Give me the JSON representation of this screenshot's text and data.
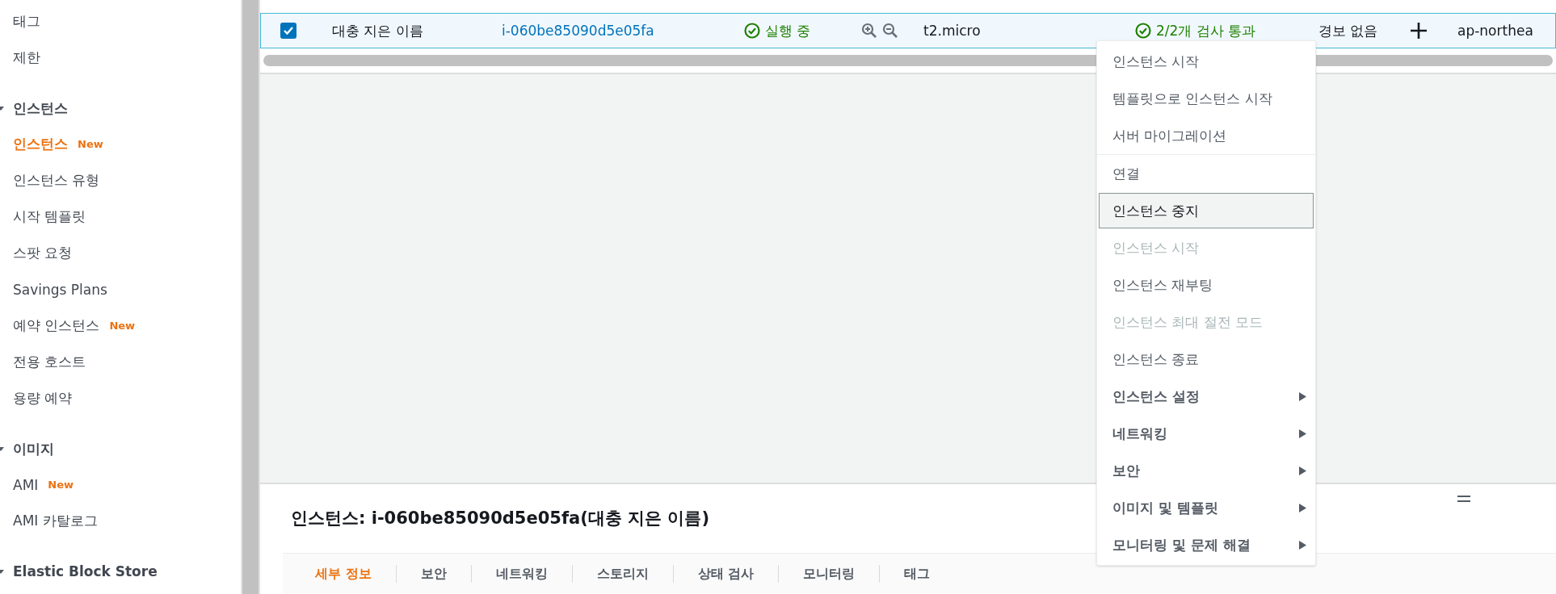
{
  "sidebar": {
    "sections": [
      {
        "items": [
          {
            "label": "태그",
            "selected": false
          },
          {
            "label": "제한",
            "selected": false
          }
        ]
      },
      {
        "title": "인스턴스",
        "expanded": true,
        "items": [
          {
            "label": "인스턴스",
            "selected": true,
            "badge": "New"
          },
          {
            "label": "인스턴스 유형",
            "selected": false
          },
          {
            "label": "시작 템플릿",
            "selected": false
          },
          {
            "label": "스팟 요청",
            "selected": false
          },
          {
            "label": "Savings Plans",
            "selected": false
          },
          {
            "label": "예약 인스턴스",
            "selected": false,
            "badge": "New"
          },
          {
            "label": "전용 호스트",
            "selected": false
          },
          {
            "label": "용량 예약",
            "selected": false
          }
        ]
      },
      {
        "title": "이미지",
        "expanded": true,
        "items": [
          {
            "label": "AMI",
            "selected": false,
            "badge": "New"
          },
          {
            "label": "AMI 카탈로그",
            "selected": false
          }
        ]
      },
      {
        "title": "Elastic Block Store",
        "expanded": true
      }
    ]
  },
  "table": {
    "row": {
      "checked": true,
      "name": "대충 지은 이름",
      "instance_id": "i-060be85090d5e05fa",
      "state": "실행 중",
      "type": "t2.micro",
      "status_check": "2/2개 검사 통과",
      "alarm": "경보 없음",
      "availability_zone": "ap-northea"
    }
  },
  "context_menu": {
    "groups": [
      [
        {
          "kind": "action",
          "label": "인스턴스 시작",
          "disabled": false,
          "selected": false
        },
        {
          "kind": "action",
          "label": "템플릿으로 인스턴스 시작",
          "disabled": false,
          "selected": false
        },
        {
          "kind": "action",
          "label": "서버 마이그레이션",
          "disabled": false,
          "selected": false
        }
      ],
      [
        {
          "kind": "action",
          "label": "연결",
          "disabled": false,
          "selected": false
        },
        {
          "kind": "action",
          "label": "인스턴스 중지",
          "disabled": false,
          "selected": true
        },
        {
          "kind": "action",
          "label": "인스턴스 시작",
          "disabled": true,
          "selected": false
        },
        {
          "kind": "action",
          "label": "인스턴스 재부팅",
          "disabled": false,
          "selected": false
        },
        {
          "kind": "action",
          "label": "인스턴스 최대 절전 모드",
          "disabled": true,
          "selected": false
        },
        {
          "kind": "action",
          "label": "인스턴스 종료",
          "disabled": false,
          "selected": false
        },
        {
          "kind": "submenu",
          "label": "인스턴스 설정",
          "disabled": false,
          "selected": false
        },
        {
          "kind": "submenu",
          "label": "네트워킹",
          "disabled": false,
          "selected": false
        },
        {
          "kind": "submenu",
          "label": "보안",
          "disabled": false,
          "selected": false
        },
        {
          "kind": "submenu",
          "label": "이미지 및 템플릿",
          "disabled": false,
          "selected": false
        },
        {
          "kind": "submenu",
          "label": "모니터링 및 문제 해결",
          "disabled": false,
          "selected": false
        }
      ]
    ]
  },
  "details": {
    "title": "인스턴스: i-060be85090d5e05fa(대충 지은 이름)",
    "tabs": [
      {
        "label": "세부 정보",
        "selected": true
      },
      {
        "label": "보안",
        "selected": false
      },
      {
        "label": "네트워킹",
        "selected": false
      },
      {
        "label": "스토리지",
        "selected": false
      },
      {
        "label": "상태 검사",
        "selected": false
      },
      {
        "label": "모니터링",
        "selected": false
      },
      {
        "label": "태그",
        "selected": false
      }
    ]
  }
}
